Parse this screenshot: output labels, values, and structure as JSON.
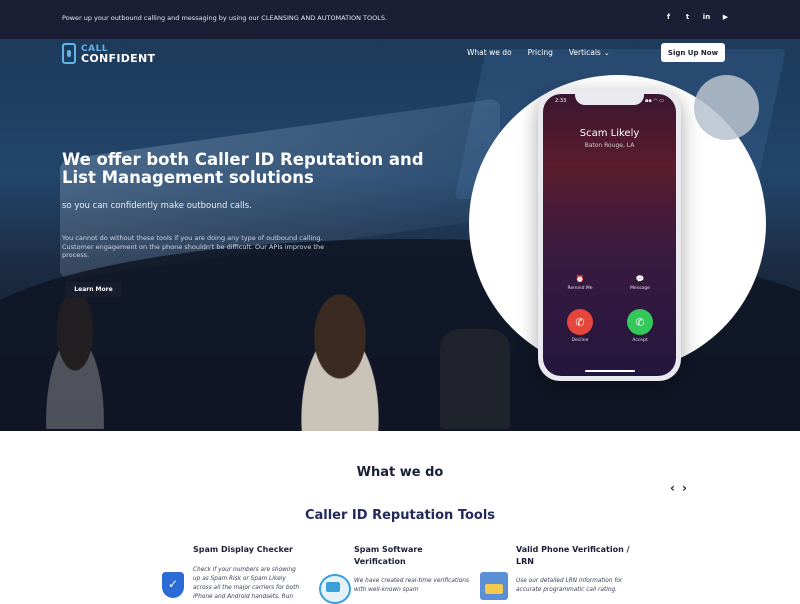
{
  "topbar": {
    "message": "Power up your outbound calling and messaging by using our CLEANSING AND AUTOMATION TOOLS.",
    "social": [
      {
        "icon": "facebook-icon",
        "glyph": "f"
      },
      {
        "icon": "twitter-icon",
        "glyph": "t"
      },
      {
        "icon": "linkedin-icon",
        "glyph": "in"
      },
      {
        "icon": "youtube-icon",
        "glyph": "▶"
      }
    ]
  },
  "nav": {
    "logo_line1": "CALL",
    "logo_line2": "CONFIDENT",
    "items": [
      "What we do",
      "Pricing",
      "Verticals"
    ],
    "verticals_chevron": "⌄",
    "signup_label": "Sign Up Now"
  },
  "hero": {
    "title": "We offer both Caller ID Reputation and List Management solutions",
    "subtitle": "so you can confidently make outbound calls.",
    "paragraph": "You cannot do without these tools if you are doing any type of outbound calling. Customer engagement on the phone shouldn't be difficult. Our APIs improve the process.",
    "cta_label": "Learn More"
  },
  "phone": {
    "time": "2:33",
    "status": "▪▪ ◠ ▭",
    "caller_name": "Scam Likely",
    "caller_location": "Baton Rouge, LA",
    "remind_label": "Remind Me",
    "message_label": "Message",
    "decline_label": "Decline",
    "accept_label": "Accept"
  },
  "section": {
    "heading": "What we do",
    "prev_arrow": "‹",
    "next_arrow": "›",
    "subheading": "Caller ID Reputation Tools"
  },
  "cards": [
    {
      "title": "Spam Display Checker",
      "text": "Check if your numbers are showing up as Spam Risk or Spam Likely across all the major carriers for both iPhone and Android handsets. Run",
      "icon": "shield-check-icon"
    },
    {
      "title": "Spam Software Verification",
      "text": "We have created real-time verifications with well-known spam",
      "icon": "id-card-icon"
    },
    {
      "title": "Valid Phone Verification / LRN",
      "text": "Use our detailed LRN information for accurate programmatic call rating.",
      "icon": "lrn-document-icon"
    }
  ],
  "colors": {
    "navy": "#1b1f35",
    "accent_blue": "#62b3e8",
    "decline_red": "#e6453b",
    "accept_green": "#34c759"
  }
}
